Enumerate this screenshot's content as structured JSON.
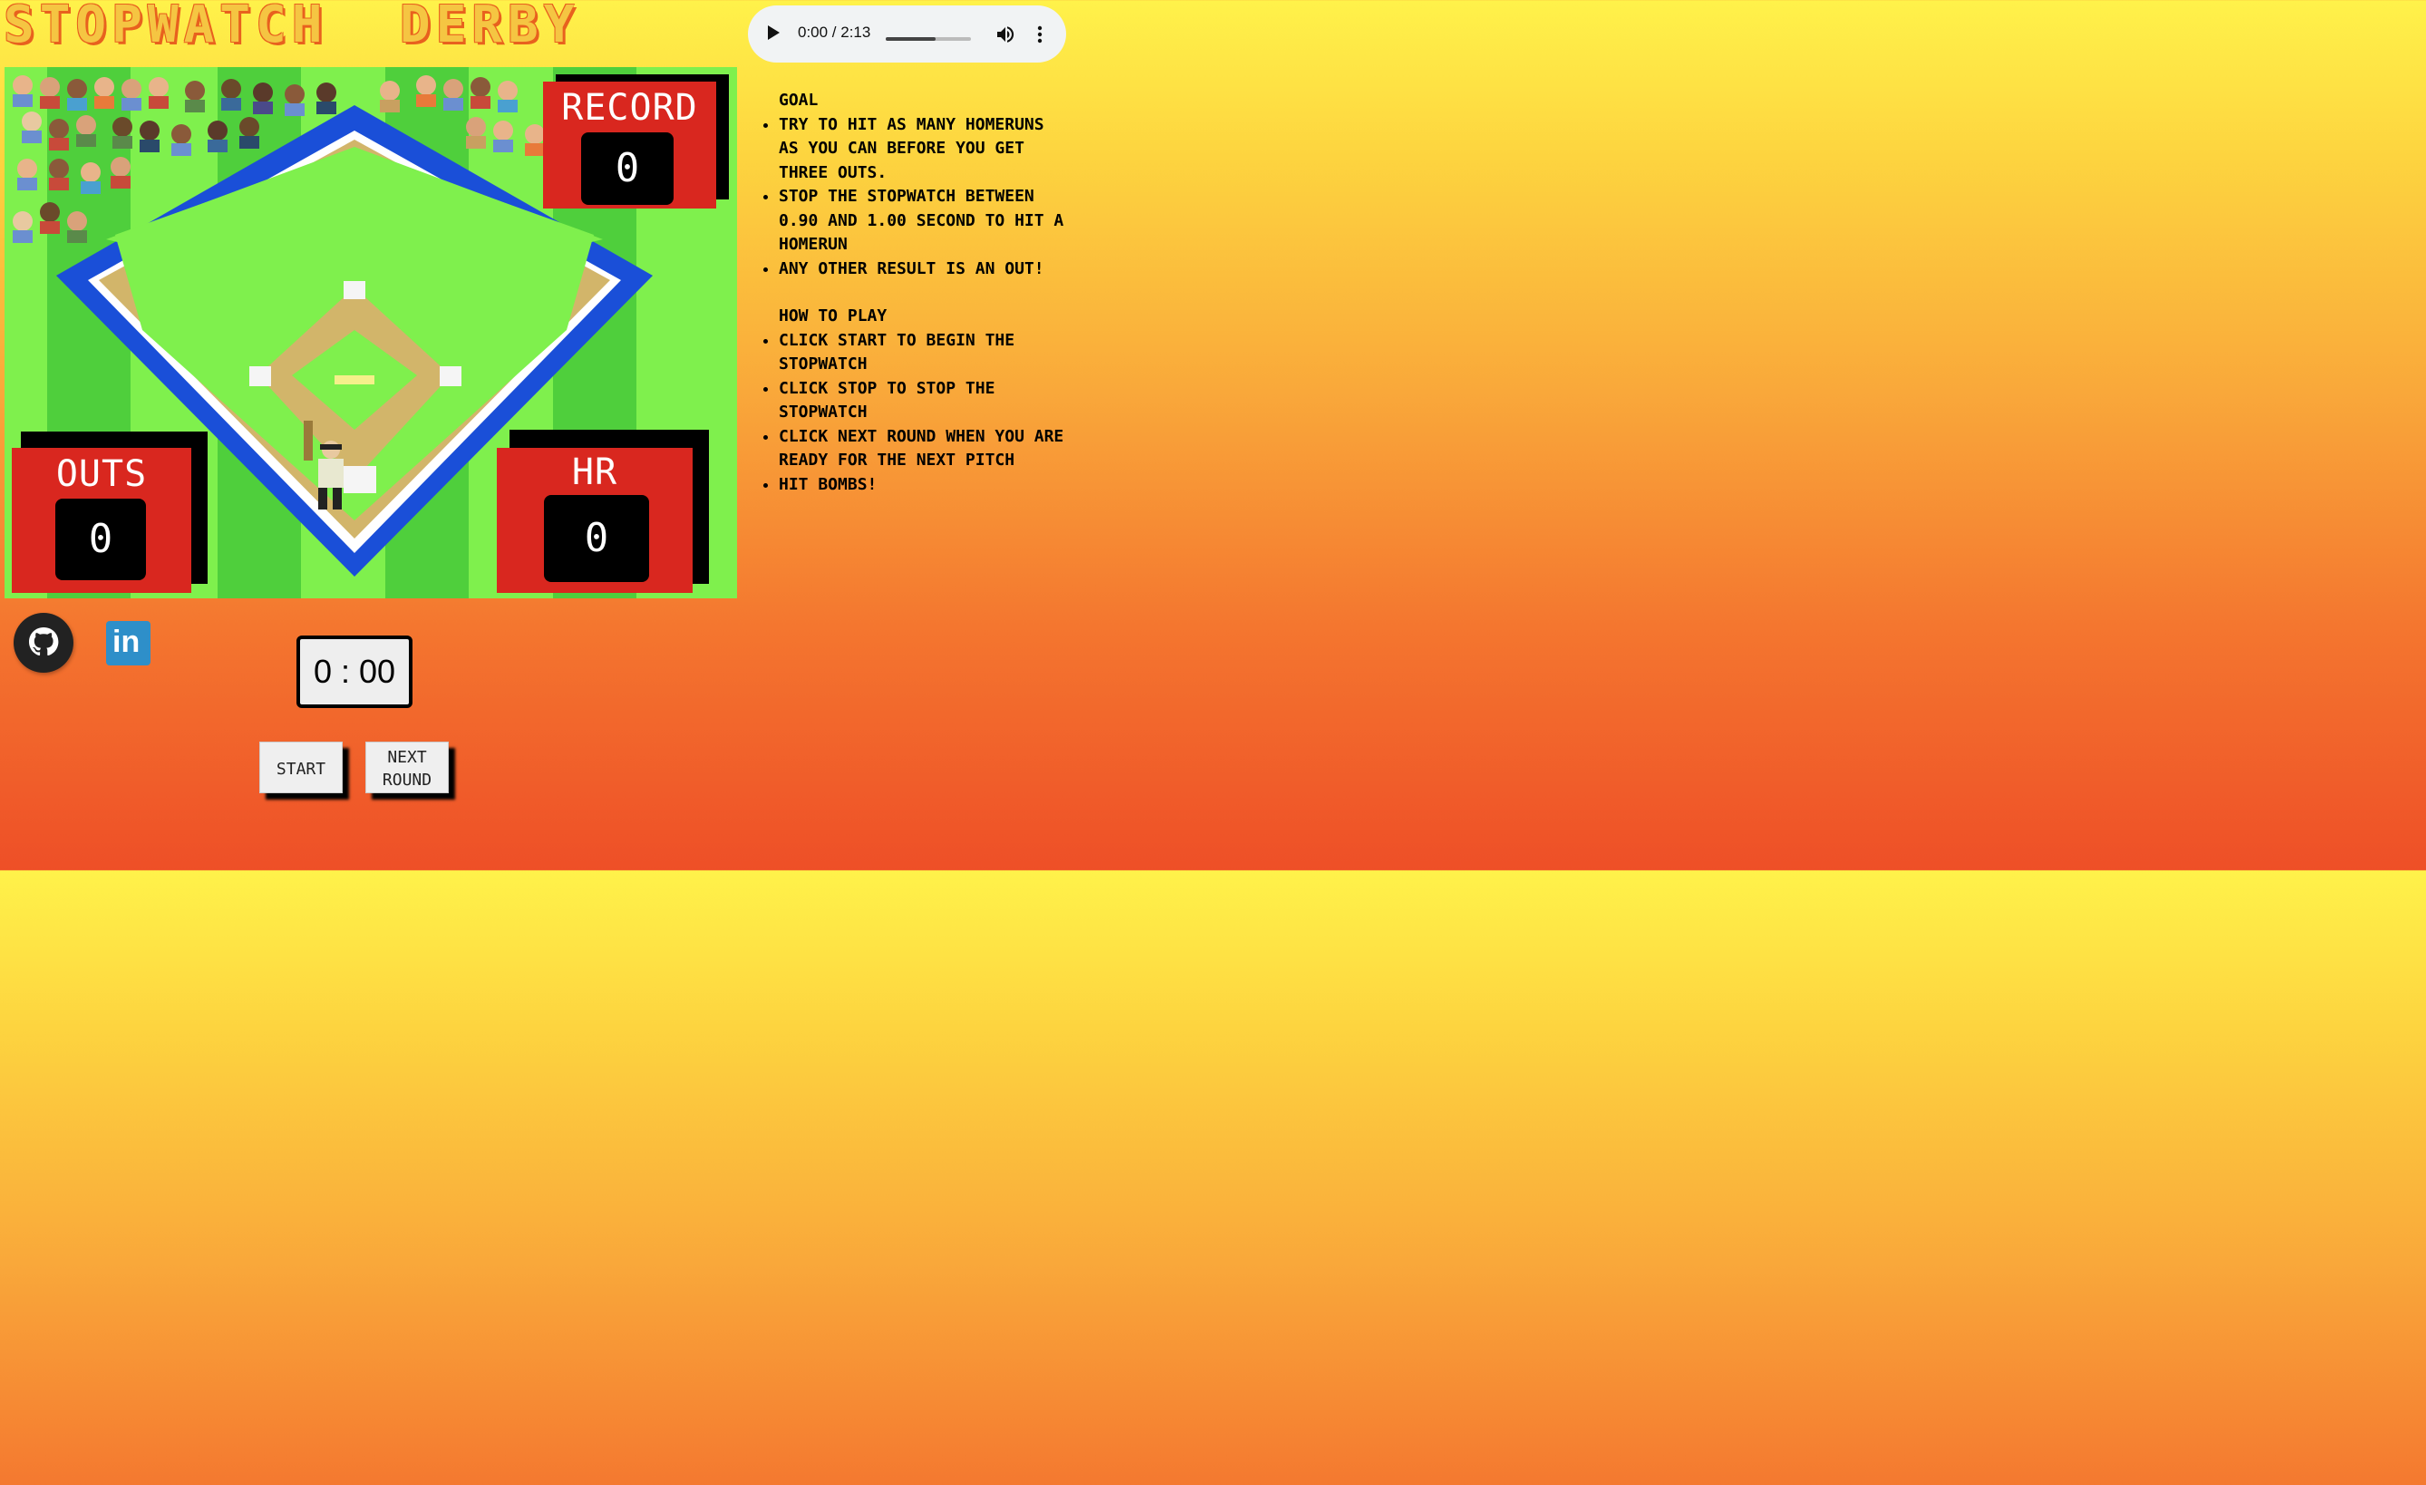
{
  "app": {
    "title": "STOPWATCH  DERBY"
  },
  "audio": {
    "time": "0:00 / 2:13",
    "progress": 0.58
  },
  "scoreboards": {
    "record": {
      "label": "RECORD",
      "value": "0"
    },
    "outs": {
      "label": "OUTS",
      "value": "0"
    },
    "hr": {
      "label": "HR",
      "value": "0"
    }
  },
  "instructions": {
    "goal_heading": "GOAL",
    "goal_items": [
      "TRY TO HIT AS MANY HOMERUNS AS YOU CAN BEFORE YOU GET THREE OUTS.",
      "STOP THE STOPWATCH BETWEEN 0.90 AND 1.00 SECOND TO HIT A HOMERUN",
      "ANY OTHER RESULT IS AN OUT!"
    ],
    "how_heading": "HOW TO PLAY",
    "how_items": [
      "CLICK START TO BEGIN THE STOPWATCH",
      "CLICK STOP TO STOP THE STOPWATCH",
      "CLICK NEXT ROUND WHEN YOU ARE READY FOR THE NEXT PITCH",
      "HIT BOMBS!"
    ]
  },
  "social": {
    "github_icon": "github-icon",
    "linkedin_icon": "linkedin-icon",
    "linkedin_text": "in"
  },
  "stopwatch": {
    "display": "0 : 00"
  },
  "buttons": {
    "start": "START",
    "next_round_line1": "NEXT",
    "next_round_line2": "ROUND"
  },
  "colors": {
    "field_green": "#7ff04d",
    "stripe_green": "#4fcf3c",
    "wall_blue": "#1a4fd8",
    "dirt": "#d2b56a",
    "board_red": "#d9271f"
  }
}
